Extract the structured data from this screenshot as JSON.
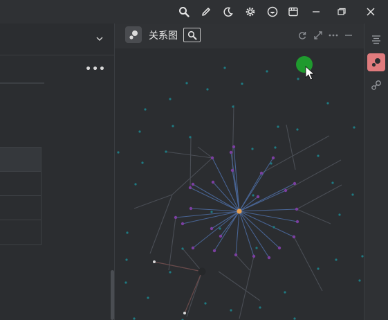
{
  "toolbar": {
    "icons": [
      "search-icon",
      "pen-icon",
      "moon-icon",
      "gear-icon",
      "emoji-icon",
      "window-icon",
      "minimize-icon",
      "restore-icon",
      "close-icon"
    ]
  },
  "left_panel": {
    "more_label": "•••"
  },
  "graph_panel": {
    "title": "关系图",
    "colors": {
      "center_node": "#e8a04f",
      "edge": "#4c6a9e",
      "node_purple": "#7b3fa0",
      "node_teal": "#1f7a82",
      "cursor_highlight": "#1f9a2e"
    }
  },
  "dock": {
    "icons": [
      "outline-icon",
      "graph-icon",
      "global-graph-icon"
    ]
  }
}
